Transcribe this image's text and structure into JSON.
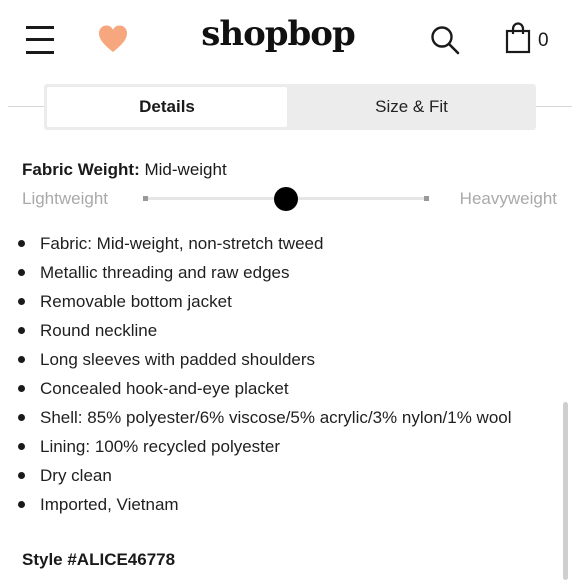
{
  "header": {
    "logo": "shopbop",
    "bag_count": "0",
    "icons": {
      "menu": "hamburger-menu-icon",
      "favorite": "heart-icon",
      "search": "search-icon",
      "bag": "shopping-bag-icon"
    },
    "colors": {
      "heart": "#f7a77e"
    }
  },
  "tabs": [
    {
      "label": "Details",
      "active": true
    },
    {
      "label": "Size & Fit",
      "active": false
    }
  ],
  "fabric_weight": {
    "label": "Fabric Weight:",
    "value": "Mid-weight",
    "min_label": "Lightweight",
    "max_label": "Heavyweight",
    "level": 0.5
  },
  "details": [
    "Fabric: Mid-weight, non-stretch tweed",
    "Metallic threading and raw edges",
    "Removable bottom jacket",
    "Round neckline",
    "Long sleeves with padded shoulders",
    "Concealed hook-and-eye placket",
    "Shell: 85% polyester/6% viscose/5% acrylic/3% nylon/1% wool",
    "Lining: 100% recycled polyester",
    "Dry clean",
    "Imported, Vietnam"
  ],
  "style": "Style #ALICE46778"
}
